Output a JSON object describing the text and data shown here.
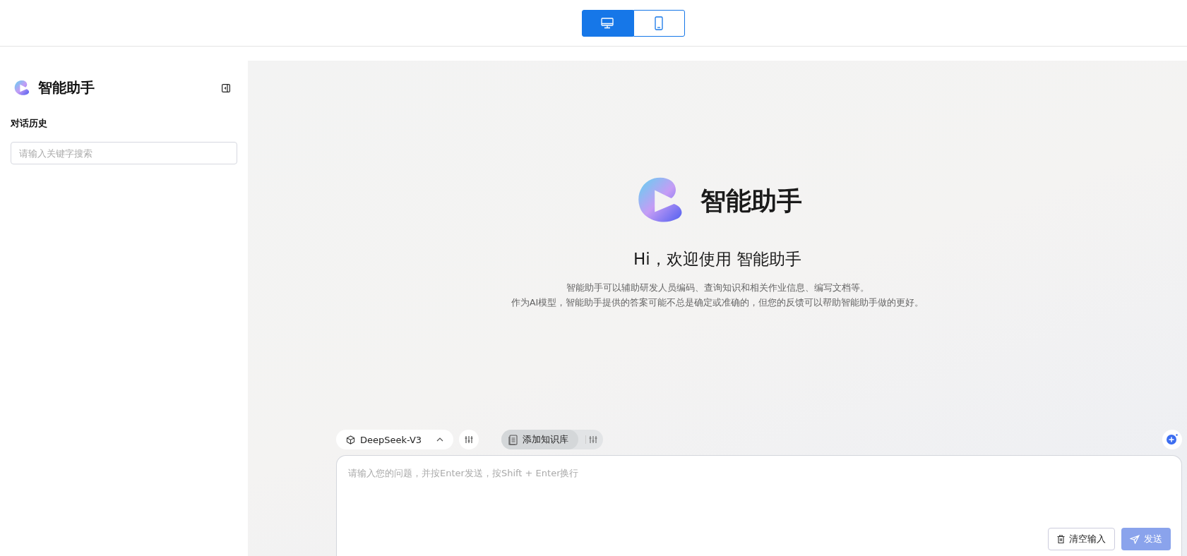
{
  "view_toggle": [
    {
      "kind": "desktop",
      "selected": true
    },
    {
      "kind": "mobile",
      "selected": false
    }
  ],
  "sidebar": {
    "app_name": "智能助手",
    "history_title": "对话历史",
    "search": {
      "placeholder": "请输入关键字搜索"
    }
  },
  "hero": {
    "app_name": "智能助手",
    "greeting": "Hi，欢迎使用 智能助手",
    "description": [
      "智能助手可以辅助研发人员编码、查询知识和相关作业信息、编写文档等。",
      "作为AI模型，智能助手提供的答案可能不总是确定或准确的，但您的反馈可以帮助智能助手做的更好。"
    ]
  },
  "composer": {
    "model": "DeepSeek-V3",
    "knowledge_button": "添加知识库",
    "input": {
      "placeholder": "请输入您的问题，并按Enter发送，按Shift + Enter换行"
    },
    "clear_button": "清空输入",
    "send_button": {
      "label": "发送",
      "disabled": true
    }
  }
}
